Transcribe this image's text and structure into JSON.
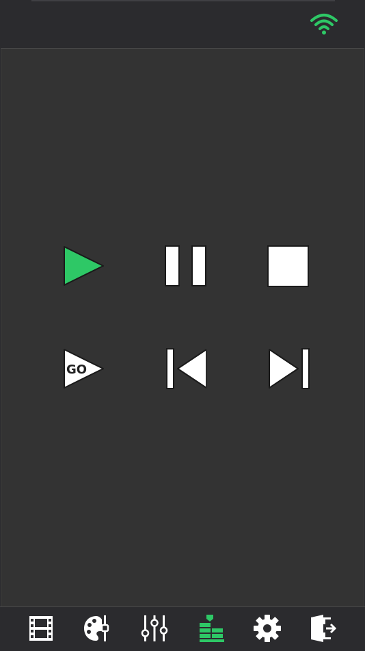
{
  "status_bar": {
    "wifi_icon": "wifi-icon",
    "wifi_color": "#2ec866"
  },
  "transport": {
    "buttons": [
      {
        "name": "play",
        "icon": "play-icon",
        "color": "#2ec866"
      },
      {
        "name": "pause",
        "icon": "pause-icon",
        "color": "#ffffff"
      },
      {
        "name": "stop",
        "icon": "stop-icon",
        "color": "#ffffff"
      },
      {
        "name": "go",
        "icon": "go-icon",
        "label": "GO",
        "color": "#ffffff"
      },
      {
        "name": "previous",
        "icon": "skip-previous-icon",
        "color": "#ffffff"
      },
      {
        "name": "next",
        "icon": "skip-next-icon",
        "color": "#ffffff"
      }
    ]
  },
  "tab_bar": {
    "active_tab": "cues",
    "active_color": "#2ec866",
    "inactive_color": "#ffffff",
    "tabs": [
      {
        "name": "media",
        "icon": "film-icon"
      },
      {
        "name": "palette",
        "icon": "palette-icon"
      },
      {
        "name": "mixer",
        "icon": "sliders-icon"
      },
      {
        "name": "cues",
        "icon": "cue-stack-icon"
      },
      {
        "name": "settings",
        "icon": "gear-icon"
      },
      {
        "name": "logout",
        "icon": "exit-door-icon"
      }
    ]
  }
}
